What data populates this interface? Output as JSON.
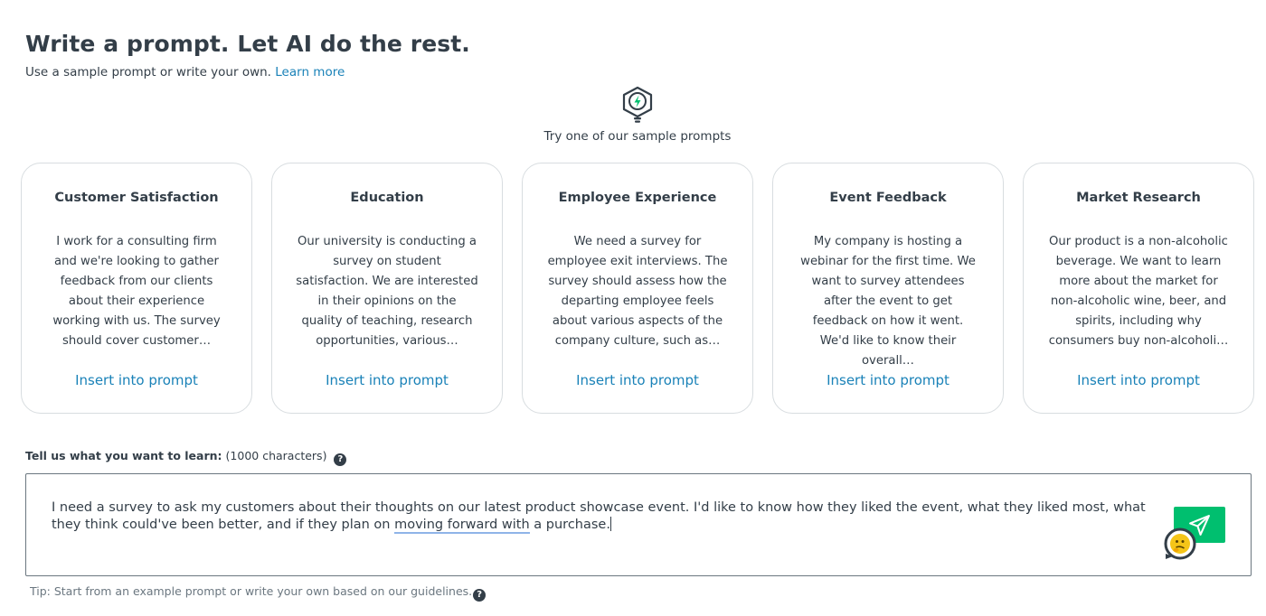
{
  "header": {
    "title": "Write a prompt. Let AI do the rest.",
    "subtitle": "Use a sample prompt or write your own.",
    "learn_more": "Learn more"
  },
  "samples": {
    "intro": "Try one of our sample prompts",
    "icon": "lightbulb-icon",
    "cards": [
      {
        "title": "Customer Satisfaction",
        "body": "I work for a consulting firm and we're looking to gather feedback from our clients about their experience working with us. The survey should cover customer…",
        "action": "Insert into prompt"
      },
      {
        "title": "Education",
        "body": "Our university is conducting a survey on student satisfaction. We are interested in their opinions on the quality of teaching, research opportunities, various…",
        "action": "Insert into prompt"
      },
      {
        "title": "Employee Experience",
        "body": "We need a survey for employee exit interviews. The survey should assess how the departing employee feels about various aspects of the company culture, such as…",
        "action": "Insert into prompt"
      },
      {
        "title": "Event Feedback",
        "body": "My company is hosting a webinar for the first time. We want to survey attendees after the event to get feedback on how it went. We'd like to know their overall…",
        "action": "Insert into prompt"
      },
      {
        "title": "Market Research",
        "body": "Our product is a non-alcoholic beverage. We want to learn more about the market for non-alcoholic wine, beer, and spirits, including why consumers buy non-alcoholi…",
        "action": "Insert into prompt"
      }
    ]
  },
  "prompt": {
    "label_bold": "Tell us what you want to learn:",
    "label_rest": "(1000 characters)",
    "value_before": "I need a survey to ask my customers about their thoughts on our latest product showcase event. I'd like to know how they liked the event, what they liked most, what they think could've been better, and if they plan on ",
    "value_underlined": "moving forward with",
    "value_after": " a purchase.",
    "send_icon": "send-icon",
    "help_icon": "question-icon"
  },
  "tip": {
    "text": "Tip: Start from an example prompt or write your own based on our guidelines."
  },
  "colors": {
    "accent_link": "#1a82b8",
    "send_button": "#00bf6f",
    "text": "#333e48"
  }
}
